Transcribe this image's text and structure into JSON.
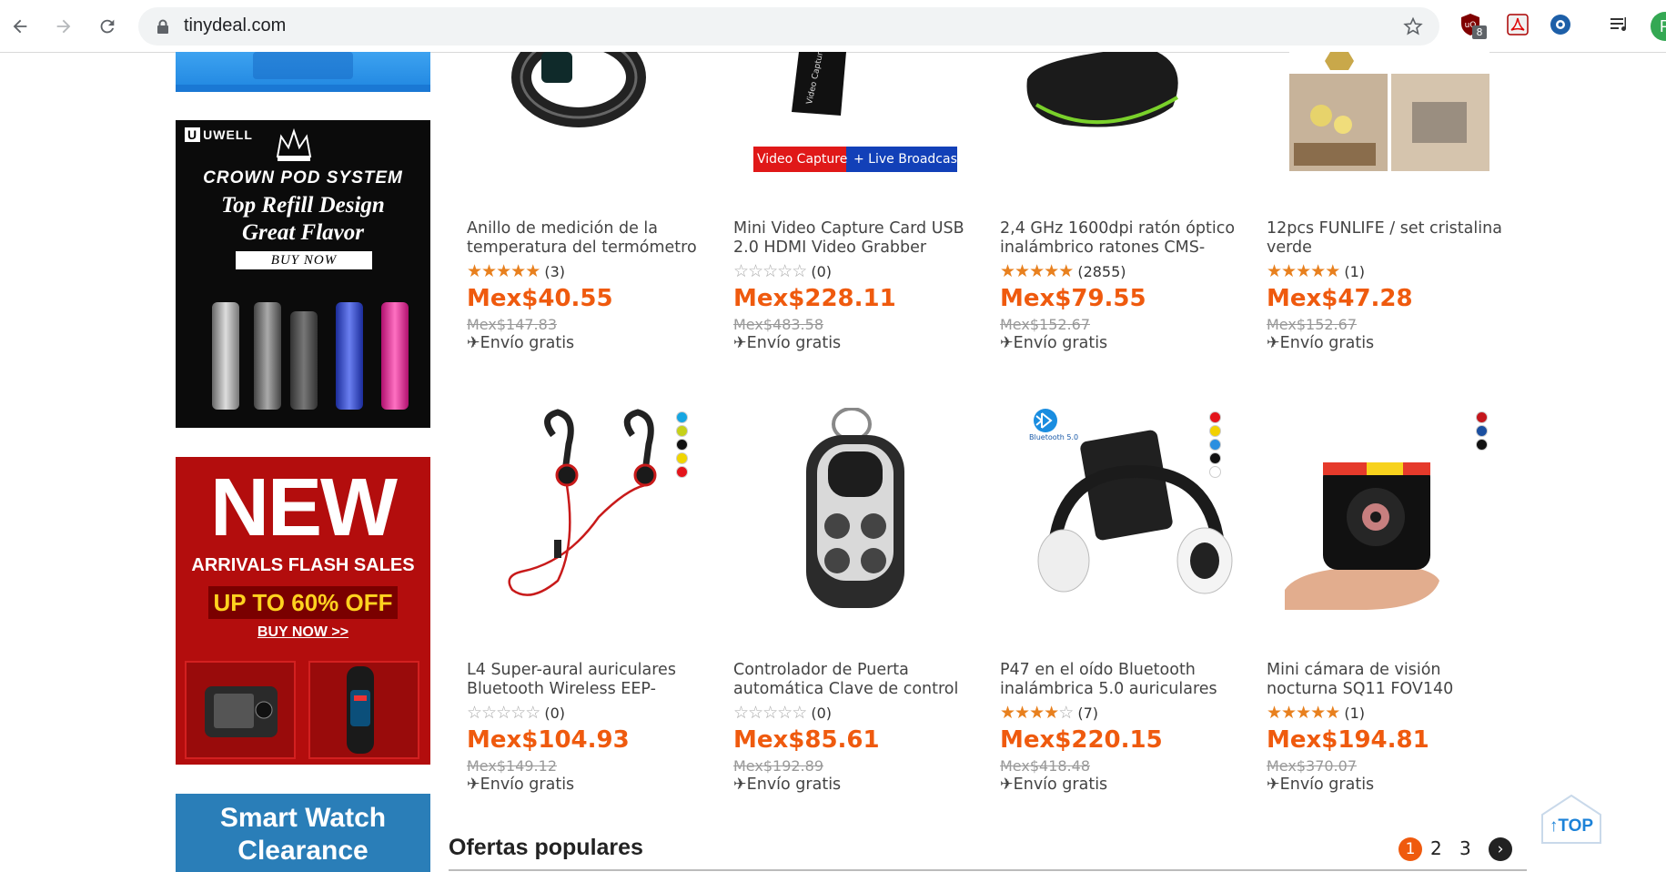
{
  "browser": {
    "url": "tinydeal.com",
    "extension_badge": "8",
    "profile_initial": "P"
  },
  "sidebar": {
    "uwell": {
      "brand": "UWELL",
      "headline": "CROWN POD SYSTEM",
      "line1": "Top Refill Design",
      "line2": "Great Flavor",
      "cta": "BUY NOW"
    },
    "flash": {
      "headline": "NEW",
      "subline": "ARRIVALS FLASH SALES",
      "discount": "UP TO 60% OFF",
      "cta": "BUY NOW >>"
    },
    "watch": {
      "line1": "Smart Watch",
      "line2": "Clearance"
    }
  },
  "products": [
    {
      "title": "Anillo de medición de la temperatura del termómetro",
      "stars": 4.5,
      "rating_count": "(3)",
      "price": "Mex$40.55",
      "old_price": "Mex$147.83",
      "shipping": "Envío gratis",
      "image": "smart-ring"
    },
    {
      "title": "Mini Video Capture Card USB 2.0 HDMI Video Grabber",
      "stars": 0,
      "rating_count": "(0)",
      "price": "Mex$228.11",
      "old_price": "Mex$483.58",
      "shipping": "Envío gratis",
      "image": "video-capture-card",
      "image_caption_a": "Video Capture",
      "image_caption_b": "+ Live Broadcast"
    },
    {
      "title": "2,4 GHz 1600dpi ratón óptico inalámbrico ratones CMS-",
      "stars": 5,
      "rating_count": "(2855)",
      "price": "Mex$79.55",
      "old_price": "Mex$152.67",
      "shipping": "Envío gratis",
      "image": "wireless-mouse"
    },
    {
      "title": "12pcs FUNLIFE / set cristalina verde",
      "stars": 4.5,
      "rating_count": "(1)",
      "price": "Mex$47.28",
      "old_price": "Mex$152.67",
      "shipping": "Envío gratis",
      "image": "mirror-stickers"
    },
    {
      "title": "L4 Super-aural auriculares Bluetooth Wireless EEP-",
      "stars": 0,
      "rating_count": "(0)",
      "price": "Mex$104.93",
      "old_price": "Mex$149.12",
      "shipping": "Envío gratis",
      "image": "sport-earphones",
      "swatches": [
        "#16a6e2",
        "#c6d11a",
        "#111111",
        "#f0d500",
        "#e4141b"
      ]
    },
    {
      "title": "Controlador de Puerta automática Clave de control",
      "stars": 0,
      "rating_count": "(0)",
      "price": "Mex$85.61",
      "old_price": "Mex$192.89",
      "shipping": "Envío gratis",
      "image": "remote-key"
    },
    {
      "title": "P47 en el oído Bluetooth inalámbrica 5.0 auriculares",
      "stars": 4,
      "rating_count": "(7)",
      "price": "Mex$220.15",
      "old_price": "Mex$418.48",
      "shipping": "Envío gratis",
      "image": "bluetooth-headphones",
      "image_caption_a": "Bluetooth 5.0",
      "swatches": [
        "#e4141b",
        "#f2d100",
        "#2b8fe0",
        "#111111",
        "#ffffff"
      ]
    },
    {
      "title": "Mini cámara de visión nocturna SQ11 FOV140",
      "stars": 5,
      "rating_count": "(1)",
      "price": "Mex$194.81",
      "old_price": "Mex$370.07",
      "shipping": "Envío gratis",
      "image": "mini-camera",
      "swatches": [
        "#c4161c",
        "#1b4fa0",
        "#111111"
      ]
    }
  ],
  "section": {
    "title": "Ofertas populares",
    "pages": [
      "1",
      "2",
      "3"
    ],
    "active_page": "1"
  },
  "top_button": "TOP",
  "colors": {
    "price": "#ef5a0e",
    "star": "#e8801e",
    "accent_blue": "#1c82d8"
  }
}
